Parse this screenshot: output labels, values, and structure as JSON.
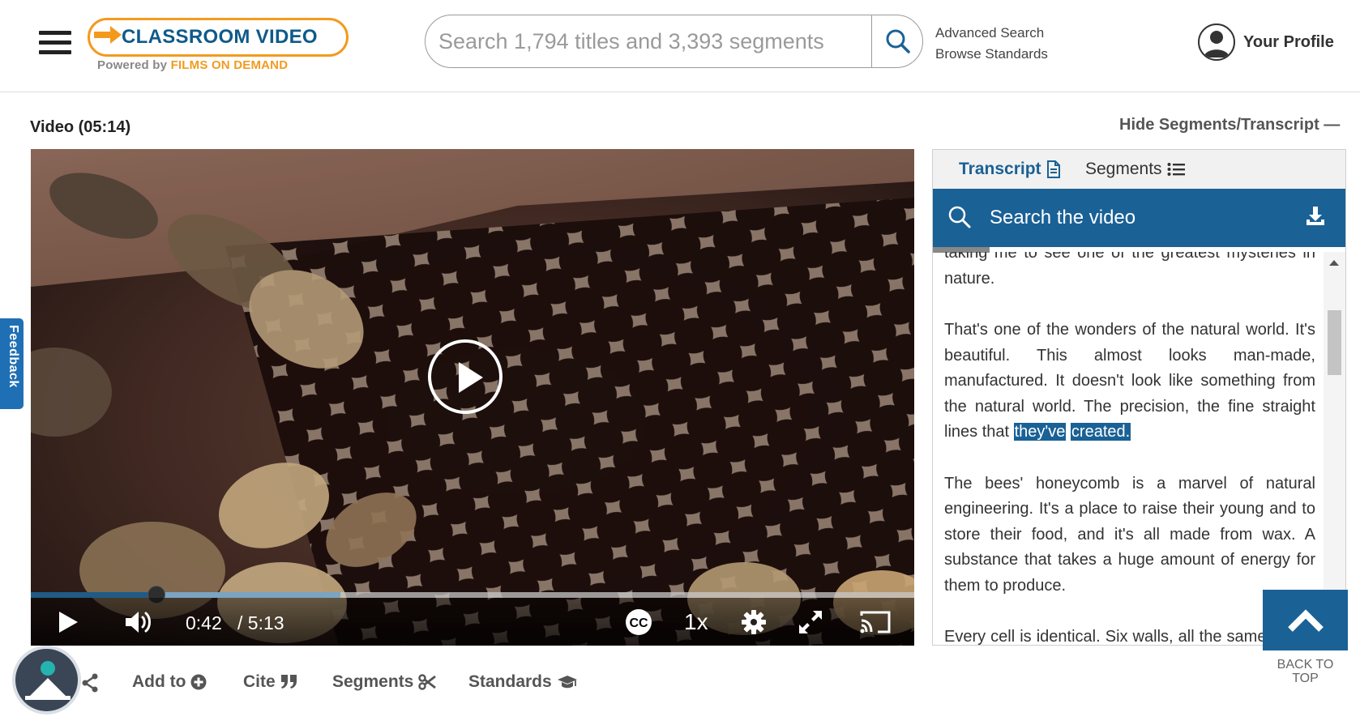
{
  "header": {
    "logo_main": "CLASSROOM VIDEO",
    "logo_powered": "Powered by",
    "logo_brand": "FILMS ON DEMAND",
    "search_placeholder": "Search 1,794 titles and 3,393 segments",
    "advanced_search": "Advanced Search",
    "browse_standards": "Browse Standards",
    "profile_label": "Your Profile"
  },
  "video": {
    "title": "Video (05:14)",
    "hide_toggle": "Hide Segments/Transcript —",
    "current_time": "0:42",
    "duration": "/ 5:13",
    "speed": "1x",
    "played_fraction": 0.1425,
    "buffered_fraction": 0.35
  },
  "actions": {
    "add_to": "Add to",
    "cite": "Cite",
    "segments": "Segments",
    "standards": "Standards"
  },
  "feedback": "Feedback",
  "panel": {
    "tab_transcript": "Transcript",
    "tab_segments": "Segments",
    "search_label": "Search the video",
    "transcript": {
      "p0": "taking me to see one of the greatest mysteries in nature.",
      "p1_before": "That's one of the wonders of the natural world. It's beautiful. This almost looks man-made, manufactured. It doesn't look like something from the natural world. The precision, the fine straight lines that ",
      "p1_hl1": "they've",
      "p1_hl2": "created.",
      "p2": "The bees' honeycomb is a marvel of natural engineering. It's a place to raise their young and to store their food, and it's all made from wax. A substance that takes a huge amount of energy for them to produce.",
      "p3": "Every cell is identical. Six walls, all the same length and all at the same angle."
    }
  },
  "back_to_top": "BACK TO TOP",
  "colors": {
    "brand_blue": "#1a6196",
    "logo_orange": "#f39a1e",
    "feedback_blue": "#1f6fb4"
  }
}
